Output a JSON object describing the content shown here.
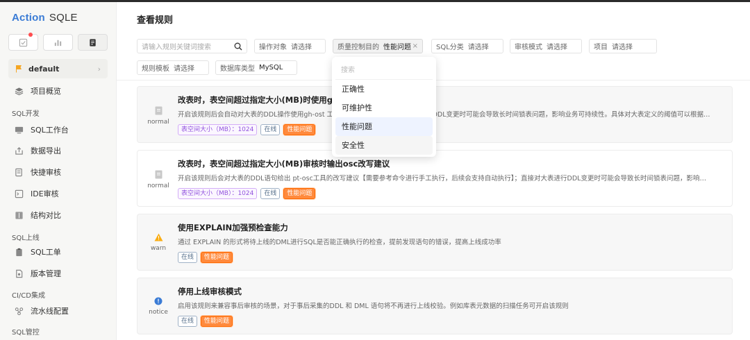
{
  "app": {
    "logo_brand": "Action",
    "logo_product": "SQLE"
  },
  "sidebar": {
    "project": "default",
    "items": {
      "overview": "项目概览",
      "group_dev": "SQL开发",
      "workbench": "SQL工作台",
      "export": "数据导出",
      "quick_audit": "快捷审核",
      "ide_audit": "IDE审核",
      "compare": "结构对比",
      "group_online": "SQL上线",
      "ticket": "SQL工单",
      "version": "版本管理",
      "group_cicd": "CI/CD集成",
      "pipeline": "流水线配置",
      "group_manage": "SQL管控"
    }
  },
  "page": {
    "title": "查看规则"
  },
  "filters": {
    "search_placeholder": "请输入规则关键词搜索",
    "operation_label": "操作对象",
    "operation_placeholder": "请选择",
    "purpose_label": "质量控制目的",
    "purpose_value": "性能问题",
    "sql_category_label": "SQL分类",
    "sql_category_placeholder": "请选择",
    "audit_mode_label": "审核模式",
    "audit_mode_placeholder": "请选择",
    "project_label": "项目",
    "project_placeholder": "请选择",
    "template_label": "规则模板",
    "template_placeholder": "请选择",
    "db_type_label": "数据库类型",
    "db_type_value": "MySQL"
  },
  "dropdown": {
    "search_placeholder": "搜索",
    "options": [
      "正确性",
      "可维护性",
      "性能问题",
      "安全性"
    ],
    "selected": "性能问题"
  },
  "rules": [
    {
      "level": "normal",
      "title": "改表时，表空间超过指定大小(MB)时使用gh-ost上线",
      "desc": "开启该规则后会自动对大表的DDL操作使用gh-ost 工具进行在线改表；直接对大表进行DDL变更时可能会导致长时间锁表问题，影响业务可持续性。具体对大表定义的阈值可以根据业务需求自行调整",
      "param_tag": "表空间大小（MB）：1024",
      "tags": [
        "在线",
        "性能问题"
      ]
    },
    {
      "level": "normal",
      "title": "改表时，表空间超过指定大小(MB)审核时输出osc改写建议",
      "desc": "开启该规则后会对大表的DDL语句给出 pt-osc工具的改写建议【需要参考命令进行手工执行，后续会支持自动执行】；直接对大表进行DDL变更时可能会导致长时间锁表问题，影响业务可持续性",
      "param_tag": "表空间大小（MB）：1024",
      "tags": [
        "在线",
        "性能问题"
      ]
    },
    {
      "level": "warn",
      "title": "使用EXPLAIN加强预检查能力",
      "desc": "通过 EXPLAIN 的形式将待上线的DML进行SQL是否能正确执行的检查，提前发现语句的错误，提高上线成功率",
      "tags": [
        "在线",
        "性能问题"
      ]
    },
    {
      "level": "notice",
      "title": "停用上线审核模式",
      "desc": "启用该规则来兼容事后审核的场景，对于事后采集的DDL 和 DML 语句将不再进行上线校验。例如库表元数据的扫描任务可开启该规则",
      "tags": [
        "在线",
        "性能问题"
      ]
    }
  ]
}
